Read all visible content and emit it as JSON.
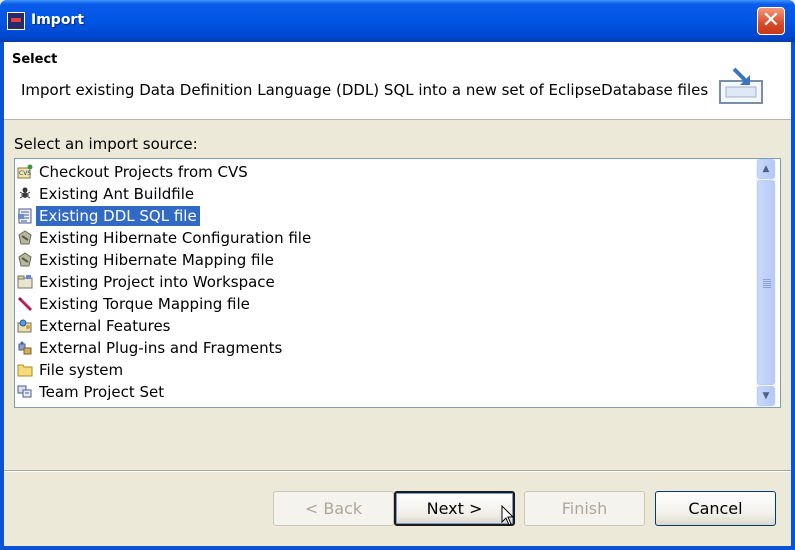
{
  "window": {
    "title": "Import",
    "close_glyph": "✕"
  },
  "header": {
    "title": "Select",
    "description": "Import existing Data Definition Language (DDL) SQL into a new set of EclipseDatabase files",
    "graphic_icon": "import-wizard-icon"
  },
  "list": {
    "label": "Select an import source:",
    "items": [
      {
        "label": "Checkout Projects from CVS",
        "icon": "cvs-icon",
        "selected": false
      },
      {
        "label": "Existing Ant Buildfile",
        "icon": "ant-icon",
        "selected": false
      },
      {
        "label": "Existing DDL SQL file",
        "icon": "ddl-icon",
        "selected": true
      },
      {
        "label": "Existing Hibernate Configuration file",
        "icon": "hibernate-icon",
        "selected": false
      },
      {
        "label": "Existing Hibernate Mapping file",
        "icon": "hibernate-icon",
        "selected": false
      },
      {
        "label": "Existing Project into Workspace",
        "icon": "project-icon",
        "selected": false
      },
      {
        "label": "Existing Torque Mapping file",
        "icon": "torque-icon",
        "selected": false
      },
      {
        "label": "External Features",
        "icon": "features-icon",
        "selected": false
      },
      {
        "label": "External Plug-ins and Fragments",
        "icon": "plugins-icon",
        "selected": false
      },
      {
        "label": "File system",
        "icon": "folder-icon",
        "selected": false
      },
      {
        "label": "Team Project Set",
        "icon": "team-icon",
        "selected": false
      }
    ]
  },
  "buttons": {
    "back": "< Back",
    "next": "Next >",
    "finish": "Finish",
    "cancel": "Cancel"
  },
  "colors": {
    "title_bar": "#0055e5",
    "selection": "#316ac5",
    "dialog_bg": "#ece9d8"
  }
}
